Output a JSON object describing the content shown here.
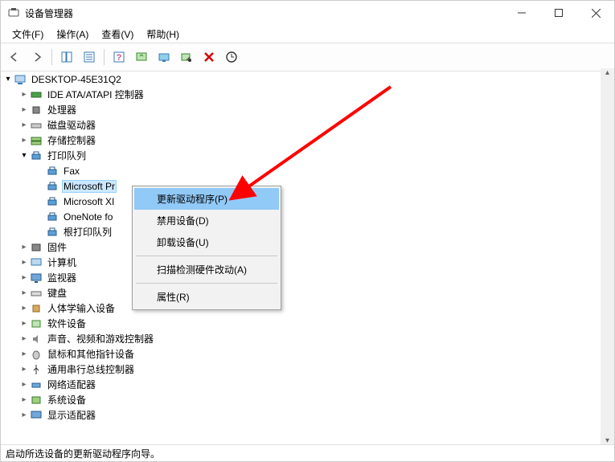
{
  "window": {
    "title": "设备管理器"
  },
  "menubar": [
    "文件(F)",
    "操作(A)",
    "查看(V)",
    "帮助(H)"
  ],
  "tree": {
    "root": "DESKTOP-45E31Q2",
    "cats": [
      {
        "label": "IDE ATA/ATAPI 控制器"
      },
      {
        "label": "处理器"
      },
      {
        "label": "磁盘驱动器"
      },
      {
        "label": "存储控制器"
      },
      {
        "label": "打印队列",
        "expanded": true,
        "children": [
          "Fax",
          "Microsoft Pr",
          "Microsoft XI",
          "OneNote fo",
          "根打印队列"
        ]
      },
      {
        "label": "固件"
      },
      {
        "label": "计算机"
      },
      {
        "label": "监视器"
      },
      {
        "label": "键盘"
      },
      {
        "label": "人体学输入设备"
      },
      {
        "label": "软件设备"
      },
      {
        "label": "声音、视频和游戏控制器"
      },
      {
        "label": "鼠标和其他指针设备"
      },
      {
        "label": "通用串行总线控制器"
      },
      {
        "label": "网络适配器"
      },
      {
        "label": "系统设备"
      },
      {
        "label": "显示适配器"
      }
    ]
  },
  "context_menu": [
    "更新驱动程序(P)",
    "禁用设备(D)",
    "卸载设备(U)",
    "扫描检测硬件改动(A)",
    "属性(R)"
  ],
  "context_menu_highlight_index": 0,
  "statusbar": {
    "text": "启动所选设备的更新驱动程序向导。"
  },
  "colors": {
    "selection": "#cce8ff",
    "menu_highlight": "#91c9f7",
    "annotation": "#ff0000"
  }
}
